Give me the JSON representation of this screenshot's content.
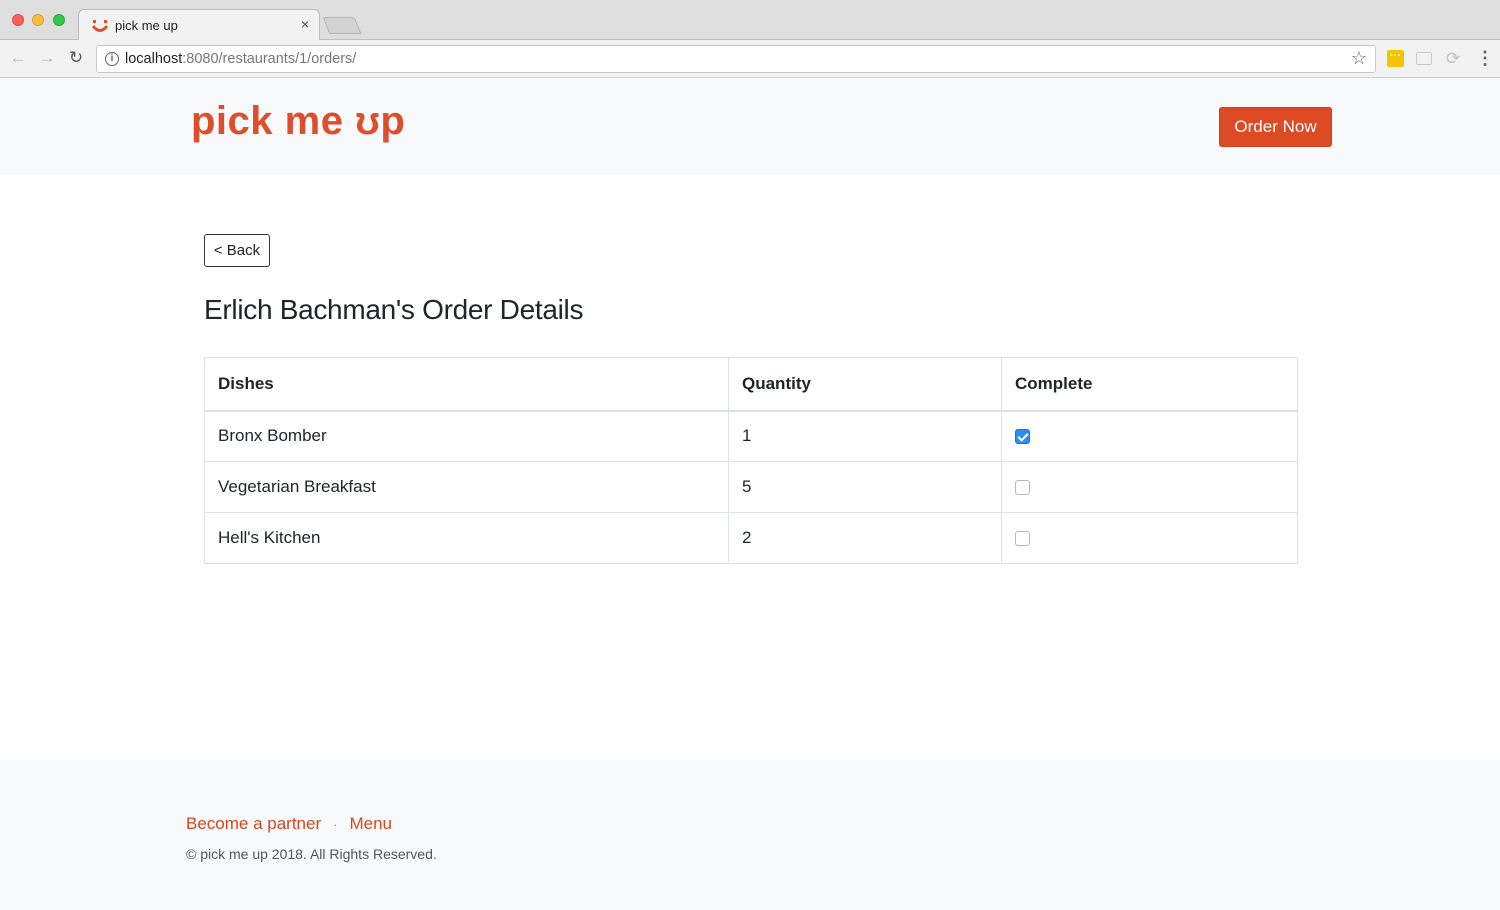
{
  "browser": {
    "tab_title": "pick me up",
    "tab_close": "×",
    "url_host": "localhost",
    "url_rest": ":8080/restaurants/1/orders/"
  },
  "header": {
    "logo": "pick me ʊp",
    "order_now": "Order Now"
  },
  "main": {
    "back_label": "< Back",
    "title": "Erlich Bachman's Order Details",
    "table": {
      "headers": [
        "Dishes",
        "Quantity",
        "Complete"
      ],
      "rows": [
        {
          "dish": "Bronx Bomber",
          "quantity": "1",
          "complete": true
        },
        {
          "dish": "Vegetarian Breakfast",
          "quantity": "5",
          "complete": false
        },
        {
          "dish": "Hell's Kitchen",
          "quantity": "2",
          "complete": false
        }
      ]
    }
  },
  "footer": {
    "links": [
      "Become a partner",
      "Menu"
    ],
    "separator": "·",
    "copyright": "© pick me up 2018. All Rights Reserved."
  },
  "colors": {
    "brand": "#de4e2c",
    "button": "#dd4a24",
    "checkbox_checked": "#2d8cf0"
  },
  "icons": {
    "nav_back": "arrow-left-icon",
    "nav_forward": "arrow-right-icon",
    "reload": "reload-icon",
    "site_info": "info-icon",
    "bookmark": "star-icon",
    "menu": "kebab-menu-icon"
  }
}
